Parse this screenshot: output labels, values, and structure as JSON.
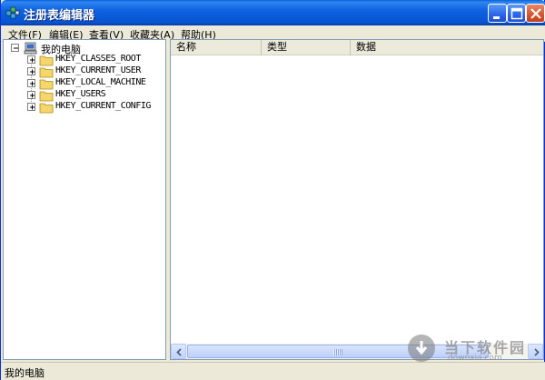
{
  "window": {
    "title": "注册表编辑器",
    "icon": "registry-editor-icon",
    "buttons": {
      "minimize": "minimize-icon",
      "maximize": "maximize-icon",
      "close": "close-icon"
    }
  },
  "menubar": {
    "items": [
      "文件(F)",
      "编辑(E)",
      "查看(V)",
      "收藏夹(A)",
      "帮助(H)"
    ]
  },
  "tree": {
    "root_label": "我的电脑",
    "root_expander": "−",
    "keys": [
      {
        "label": "HKEY_CLASSES_ROOT",
        "expander": "+"
      },
      {
        "label": "HKEY_CURRENT_USER",
        "expander": "+"
      },
      {
        "label": "HKEY_LOCAL_MACHINE",
        "expander": "+"
      },
      {
        "label": "HKEY_USERS",
        "expander": "+"
      },
      {
        "label": "HKEY_CURRENT_CONFIG",
        "expander": "+"
      }
    ]
  },
  "list": {
    "columns": [
      "名称",
      "类型",
      "数据"
    ]
  },
  "statusbar": {
    "text": "我的电脑"
  },
  "watermark": {
    "text": "当下软件园",
    "sub": "downxia.com"
  },
  "colors": {
    "titlebar": "#0a5fd8",
    "window_bg": "#ece9d8",
    "folder": "#f5d66b"
  }
}
